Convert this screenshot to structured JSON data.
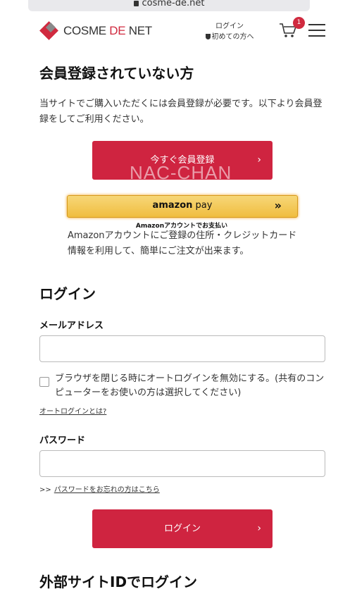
{
  "browser": {
    "url": "cosme-de.net"
  },
  "header": {
    "logo": {
      "prefix": "COSME ",
      "accent": "DE",
      "suffix": " NET"
    },
    "login_link": "ログイン",
    "first_time_link": "初めての方へ",
    "cart_count": "1",
    "icons": [
      "lock-icon",
      "shield-icon",
      "cart-icon",
      "menu-icon"
    ]
  },
  "register": {
    "heading": "会員登録されていない方",
    "description": "当サイトでご購入いただくには会員登録が必要です。以下より会員登録をしてご利用ください。",
    "button_label": "今すぐ会員登録",
    "chevron": "›"
  },
  "watermark": "NAC-CHAN",
  "amazon_pay": {
    "brand": "amazon",
    "pay": " pay",
    "arrows": "»",
    "sub_label": "Amazonアカウントでお支払い",
    "description": "Amazonアカウントにご登録の住所・クレジットカード情報を利用して、簡単にご注文が出来ます。"
  },
  "login": {
    "heading": "ログイン",
    "email_label": "メールアドレス",
    "email_value": "",
    "auto_login_text": "ブラウザを閉じる時にオートログインを無効にする。(共有のコンピューターをお使いの方は選択してください)",
    "auto_login_checked": false,
    "auto_login_help": "オートログインとは?",
    "password_label": "パスワード",
    "password_value": "",
    "forgot_prefix": ">>",
    "forgot_link": "パスワードをお忘れの方はこちら",
    "button_label": "ログイン",
    "chevron": "›"
  },
  "external": {
    "heading": "外部サイトIDでログイン"
  },
  "colors": {
    "brand_red": "#cf2440",
    "amazon_yellow": "#f0bd3f"
  }
}
